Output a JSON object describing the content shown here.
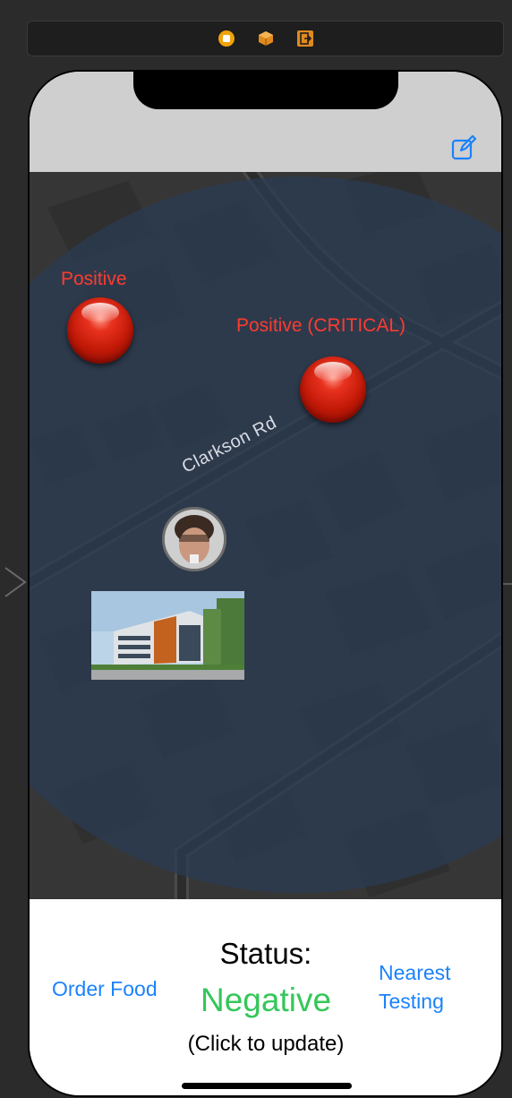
{
  "scene_dock": {
    "icons": [
      "view-controller-icon",
      "first-responder-icon",
      "exit-icon"
    ]
  },
  "nav_bar": {
    "compose_icon": "compose-icon"
  },
  "map": {
    "road_name": "Clarkson Rd",
    "pins": [
      {
        "label": "Positive"
      },
      {
        "label": "Positive (CRITICAL)"
      }
    ],
    "user_avatar": "user-avatar",
    "location_photo": "building-photo"
  },
  "bottom": {
    "order_food_label": "Order Food",
    "nearest_testing_line1": "Nearest",
    "nearest_testing_line2": "Testing",
    "status_title": "Status:",
    "status_value": "Negative",
    "status_hint": "(Click to update)"
  },
  "colors": {
    "accent": "#1a82fb",
    "positive": "#ff3b30",
    "negative": "#34c759",
    "map_overlay": "#2a3b55"
  }
}
